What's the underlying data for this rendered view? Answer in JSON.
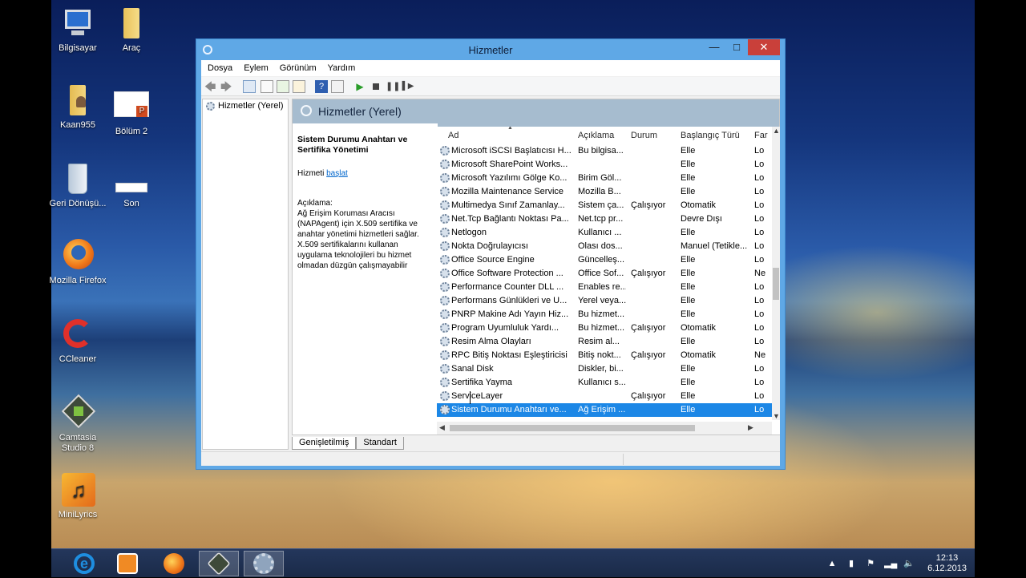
{
  "desktop": {
    "icons": [
      {
        "label": "Bilgisayar",
        "icon": "computer-icon"
      },
      {
        "label": "Araç",
        "icon": "folder-icon"
      },
      {
        "label": "Kaan955",
        "icon": "user-folder-icon"
      },
      {
        "label": "Bölüm 2",
        "icon": "powerpoint-file-icon"
      },
      {
        "label": "Geri Dönüşü...",
        "icon": "recycle-bin-icon"
      },
      {
        "label": "Son",
        "icon": "file-icon"
      },
      {
        "label": "Mozilla Firefox",
        "icon": "firefox-icon"
      },
      {
        "label": "CCleaner",
        "icon": "ccleaner-icon"
      },
      {
        "label": "Camtasia Studio 8",
        "icon": "camtasia-icon"
      },
      {
        "label": "MiniLyrics",
        "icon": "minilyrics-icon"
      }
    ]
  },
  "window": {
    "title": "Hizmetler",
    "menu": [
      "Dosya",
      "Eylem",
      "Görünüm",
      "Yardım"
    ],
    "tree": {
      "item": "Hizmetler (Yerel)"
    },
    "pane": {
      "title": "Hizmetler (Yerel)",
      "desc_title": "Sistem Durumu Anahtarı ve Sertifika Yönetimi",
      "action_prefix": "Hizmeti ",
      "action_link": "başlat",
      "desc_label": "Açıklama:",
      "desc_text": "Ağ Erişim Koruması Aracısı (NAPAgent) için X.509 sertifika ve anahtar yönetimi hizmetleri sağlar. X.509 sertifikalarını kullanan uygulama teknolojileri bu hizmet olmadan düzgün çalışmayabilir"
    },
    "columns": {
      "name": "Ad",
      "desc": "Açıklama",
      "status": "Durum",
      "startup": "Başlangıç Türü",
      "logon": "Far"
    },
    "rows": [
      {
        "name": "Microsoft iSCSI Başlatıcısı H...",
        "desc": "Bu bilgisa...",
        "status": "",
        "startup": "Elle",
        "logon": "Lo"
      },
      {
        "name": "Microsoft SharePoint Works...",
        "desc": "",
        "status": "",
        "startup": "Elle",
        "logon": "Lo"
      },
      {
        "name": "Microsoft Yazılımı Gölge Ko...",
        "desc": "Birim Göl...",
        "status": "",
        "startup": "Elle",
        "logon": "Lo"
      },
      {
        "name": "Mozilla Maintenance Service",
        "desc": "Mozilla B...",
        "status": "",
        "startup": "Elle",
        "logon": "Lo"
      },
      {
        "name": "Multimedya Sınıf Zamanlay...",
        "desc": "Sistem ça...",
        "status": "Çalışıyor",
        "startup": "Otomatik",
        "logon": "Lo"
      },
      {
        "name": "Net.Tcp Bağlantı Noktası Pa...",
        "desc": "Net.tcp pr...",
        "status": "",
        "startup": "Devre Dışı",
        "logon": "Lo"
      },
      {
        "name": "Netlogon",
        "desc": "Kullanıcı ...",
        "status": "",
        "startup": "Elle",
        "logon": "Lo"
      },
      {
        "name": "Nokta Doğrulayıcısı",
        "desc": "Olası dos...",
        "status": "",
        "startup": "Manuel (Tetikle...",
        "logon": "Lo"
      },
      {
        "name": "Office  Source Engine",
        "desc": "Güncelleş...",
        "status": "",
        "startup": "Elle",
        "logon": "Lo"
      },
      {
        "name": "Office Software Protection ...",
        "desc": "Office Sof...",
        "status": "Çalışıyor",
        "startup": "Elle",
        "logon": "Ne"
      },
      {
        "name": "Performance Counter DLL ...",
        "desc": "Enables re...",
        "status": "",
        "startup": "Elle",
        "logon": "Lo"
      },
      {
        "name": "Performans Günlükleri ve U...",
        "desc": "Yerel veya...",
        "status": "",
        "startup": "Elle",
        "logon": "Lo"
      },
      {
        "name": "PNRP Makine Adı Yayın Hiz...",
        "desc": "Bu hizmet...",
        "status": "",
        "startup": "Elle",
        "logon": "Lo"
      },
      {
        "name": "Program Uyumluluk Yardı...",
        "desc": "Bu hizmet...",
        "status": "Çalışıyor",
        "startup": "Otomatik",
        "logon": "Lo"
      },
      {
        "name": "Resim Alma Olayları",
        "desc": "Resim al...",
        "status": "",
        "startup": "Elle",
        "logon": "Lo"
      },
      {
        "name": "RPC Bitiş Noktası Eşleştiricisi",
        "desc": "Bitiş nokt...",
        "status": "Çalışıyor",
        "startup": "Otomatik",
        "logon": "Ne"
      },
      {
        "name": "Sanal Disk",
        "desc": "Diskler, bi...",
        "status": "",
        "startup": "Elle",
        "logon": "Lo"
      },
      {
        "name": "Sertifika Yayma",
        "desc": "Kullanıcı s...",
        "status": "",
        "startup": "Elle",
        "logon": "Lo"
      },
      {
        "name": "ServiceLayer",
        "desc": "",
        "status": "Çalışıyor",
        "startup": "Elle",
        "logon": "Lo"
      },
      {
        "name": "Sistem Durumu Anahtarı ve...",
        "desc": "Ağ Erişim ...",
        "status": "",
        "startup": "Elle",
        "logon": "Lo",
        "selected": true
      }
    ],
    "tabs": [
      "Genişletilmiş",
      "Standart"
    ]
  },
  "taskbar": {
    "apps": [
      "internet-explorer-icon",
      "media-player-icon",
      "firefox-icon",
      "camtasia-recorder-icon",
      "services-gear-icon"
    ],
    "time": "12:13",
    "date": "6.12.2013"
  }
}
